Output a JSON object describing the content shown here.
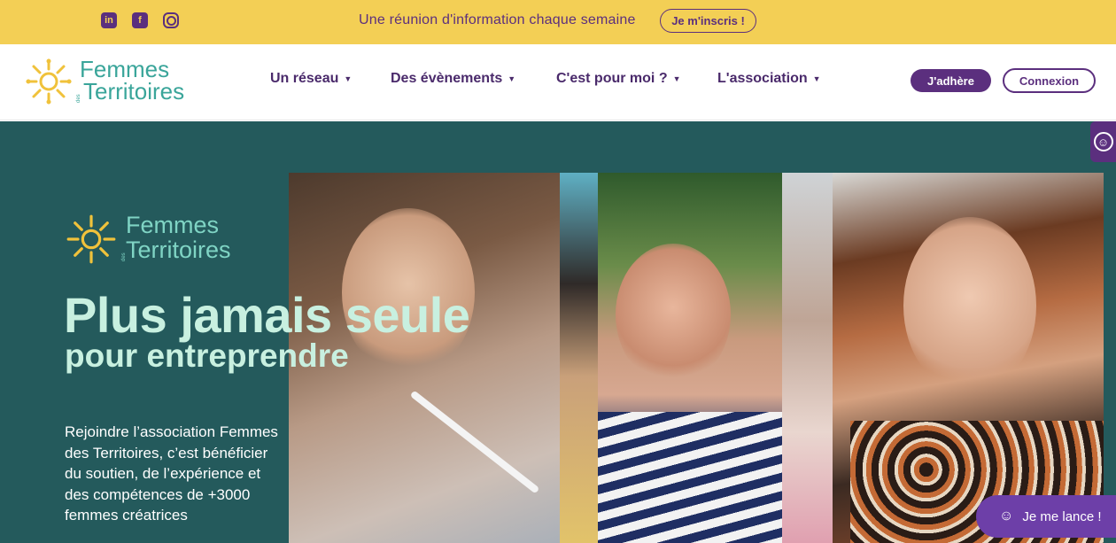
{
  "topbar": {
    "social": [
      {
        "icon": "linkedin-icon",
        "label": "in"
      },
      {
        "icon": "facebook-icon",
        "label": "f"
      },
      {
        "icon": "instagram-icon",
        "label": ""
      }
    ],
    "announcement": "Une réunion d'information chaque semaine",
    "signup_button": "Je m'inscris !"
  },
  "header": {
    "logo": {
      "line1": "Femmes",
      "small": "des",
      "line2": "Territoires"
    },
    "nav": [
      {
        "label": "Un réseau"
      },
      {
        "label": "Des évènements"
      },
      {
        "label": "C'est pour moi ?"
      },
      {
        "label": "L'association"
      }
    ],
    "join_button": "J'adhère",
    "login_button": "Connexion"
  },
  "hero": {
    "logo": {
      "line1": "Femmes",
      "small": "des",
      "line2": "Territoires"
    },
    "title": "Plus jamais seule",
    "subtitle": "pour entreprendre",
    "description": "Rejoindre l’association Femmes des Territoires, c’est bénéficier du soutien, de l’expérience et des compétences de +3000 femmes créatrices"
  },
  "accessibility_toggle": {
    "icon": "accessibility-icon"
  },
  "chat": {
    "label": "Je me lance !",
    "icon": "smile-icon"
  },
  "colors": {
    "topbar": "#f3cf55",
    "brand_purple": "#5b2f7e",
    "brand_teal": "#3aa59a",
    "hero_bg": "#245a5c",
    "hero_text": "#c8f0e0"
  }
}
